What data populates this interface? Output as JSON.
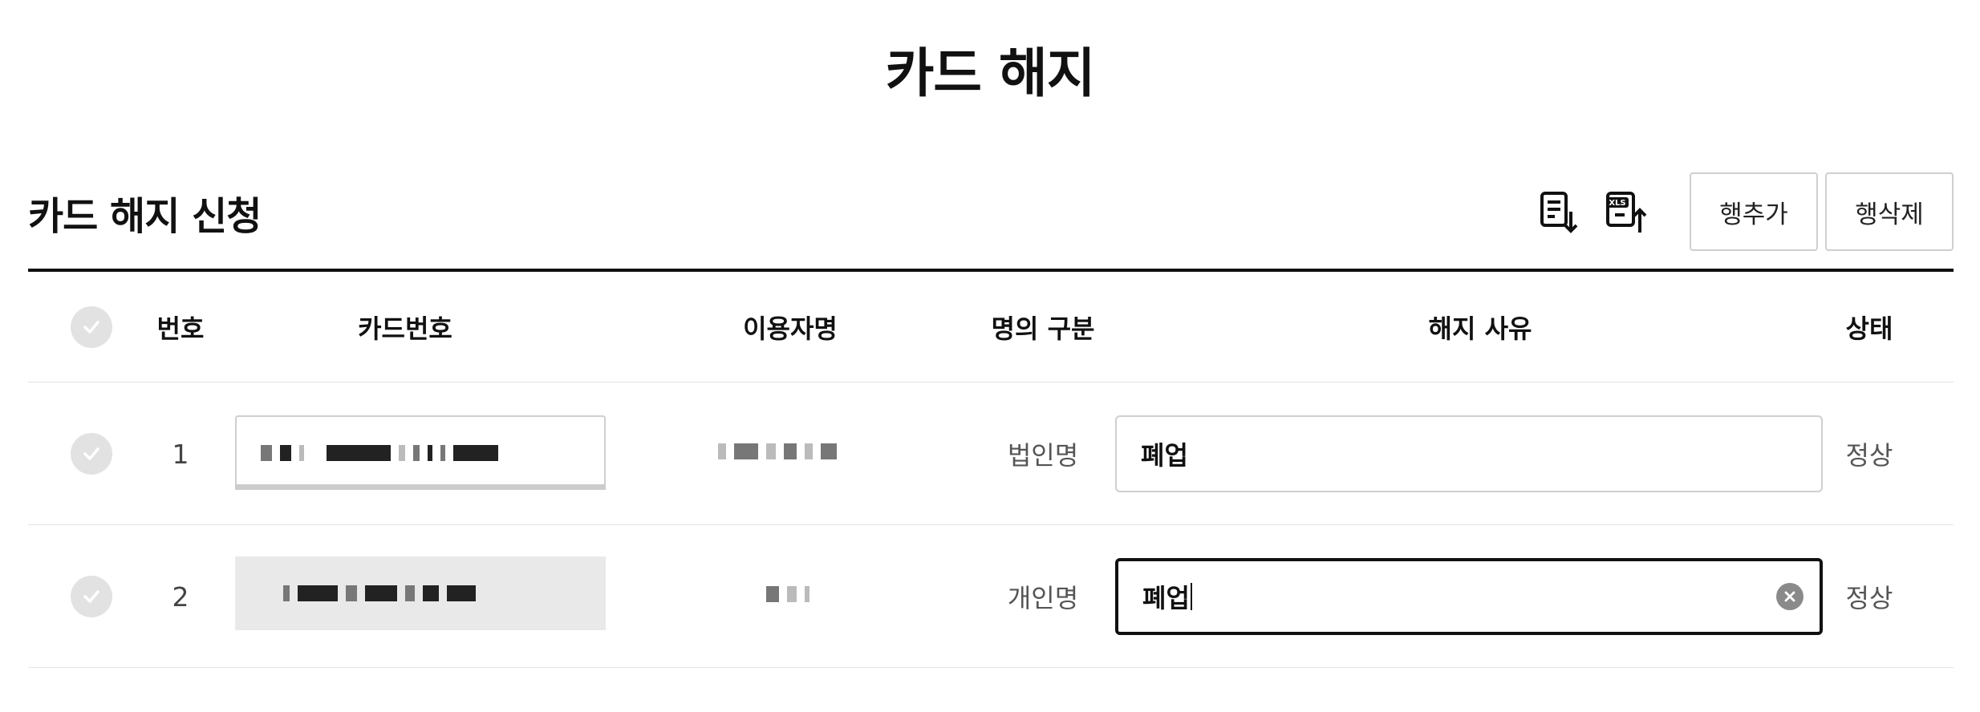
{
  "page": {
    "title": "카드 해지"
  },
  "section": {
    "title": "카드 해지 신청"
  },
  "toolbar": {
    "download_icon": "download-list-icon",
    "upload_icon": "xls-upload-icon",
    "xls_label": "XLS",
    "add_row_label": "행추가",
    "delete_row_label": "행삭제"
  },
  "table": {
    "columns": {
      "number": "번호",
      "card_number": "카드번호",
      "user_name": "이용자명",
      "name_type": "명의 구분",
      "reason": "해지 사유",
      "status": "상태"
    },
    "rows": [
      {
        "number": "1",
        "name_type": "법인명",
        "reason": "폐업",
        "status": "정상"
      },
      {
        "number": "2",
        "name_type": "개인명",
        "reason": "폐업",
        "status": "정상"
      }
    ]
  },
  "colors": {
    "primary_text": "#111111",
    "border": "#cfcfcf",
    "check_circle": "#e2e2e2",
    "active_border": "#111111"
  }
}
